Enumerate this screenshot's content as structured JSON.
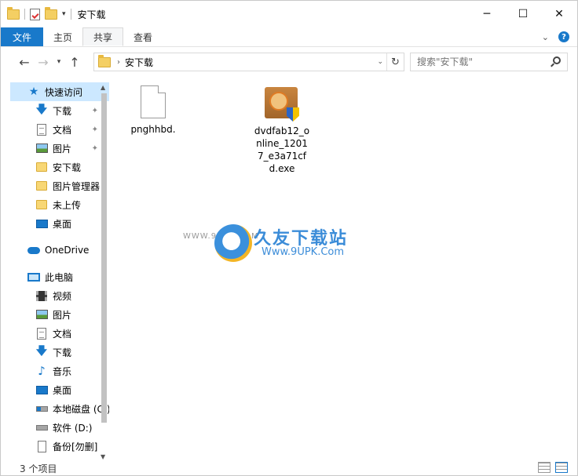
{
  "window": {
    "title": "安下载",
    "minimize": "─",
    "maximize": "☐",
    "close": "✕"
  },
  "ribbon": {
    "tabs": [
      "文件",
      "主页",
      "共享",
      "查看"
    ],
    "expand": "⌄",
    "help": "?"
  },
  "nav": {
    "back": "←",
    "forward": "→",
    "recent": "▾",
    "up": "↑"
  },
  "address": {
    "crumb": "安下载",
    "separator": "›",
    "dropdown": "⌄",
    "refresh": "↻"
  },
  "search": {
    "placeholder": "搜索\"安下载\""
  },
  "sidebar": {
    "quick_access": "快速访问",
    "quick_items": [
      {
        "label": "下载",
        "icon": "download-arrow-icon",
        "pinned": true
      },
      {
        "label": "文档",
        "icon": "document-icon",
        "pinned": true
      },
      {
        "label": "图片",
        "icon": "pictures-icon",
        "pinned": true
      },
      {
        "label": "安下载",
        "icon": "folder-icon",
        "pinned": false
      },
      {
        "label": "图片管理器",
        "icon": "folder-icon",
        "pinned": false
      },
      {
        "label": "未上传",
        "icon": "folder-icon",
        "pinned": false
      },
      {
        "label": "桌面",
        "icon": "desktop-icon",
        "pinned": false
      }
    ],
    "onedrive": "OneDrive",
    "this_pc": "此电脑",
    "pc_items": [
      {
        "label": "视频",
        "icon": "video-icon"
      },
      {
        "label": "图片",
        "icon": "pictures-icon"
      },
      {
        "label": "文档",
        "icon": "document-icon"
      },
      {
        "label": "下载",
        "icon": "download-arrow-icon"
      },
      {
        "label": "音乐",
        "icon": "music-icon"
      },
      {
        "label": "桌面",
        "icon": "desktop-icon"
      },
      {
        "label": "本地磁盘 (C:)",
        "icon": "system-drive-icon"
      },
      {
        "label": "软件 (D:)",
        "icon": "drive-icon"
      },
      {
        "label": "备份[勿删]",
        "icon": "file-icon"
      }
    ],
    "pin_glyph": "📌"
  },
  "files": [
    {
      "name": "pnghhbd.",
      "icon": "blank-file-icon"
    },
    {
      "name": "dvdfab12_online_12017_e3a71cfd.exe",
      "icon": "dvdfab-exe-icon"
    }
  ],
  "watermark": {
    "url_small": "WWW.9UPK.COM",
    "title": "久友下载站",
    "url": "Www.9UPK.Com"
  },
  "status": {
    "count": "3 个项目"
  },
  "colors": {
    "accent": "#1979ca",
    "selection": "#cce8ff",
    "folder": "#f4cf63"
  }
}
